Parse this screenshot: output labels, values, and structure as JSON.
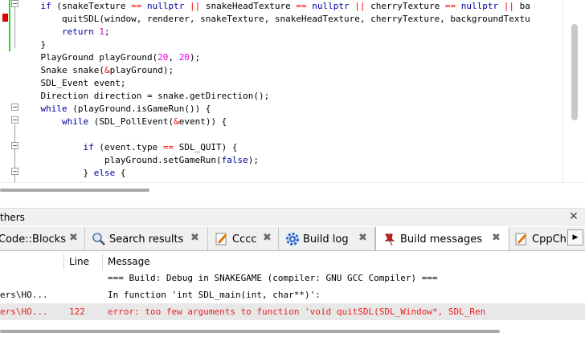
{
  "editor": {
    "lines": [
      "    if (snakeTexture == nullptr || snakeHeadTexture == nullptr || cherryTexture == nullptr || ba",
      "        quitSDL(window, renderer, snakeTexture, snakeHeadTexture, cherryTexture, backgroundTextu",
      "        return 1;",
      "    }",
      "    PlayGround playGround(20, 20);",
      "    Snake snake(&playGround);",
      "    SDL_Event event;",
      "    Direction direction = snake.getDirection();",
      "    while (playGround.isGameRun()) {",
      "        while (SDL_PollEvent(&event)) {",
      "",
      "            if (event.type == SDL_QUIT) {",
      "                playGround.setGameRun(false);",
      "            } else {"
    ]
  },
  "panel": {
    "title": "thers",
    "close_glyph": "✕"
  },
  "tabs": [
    {
      "label": "Code::Blocks",
      "icon": "codeblocks-icon"
    },
    {
      "label": "Search results",
      "icon": "search-icon"
    },
    {
      "label": "Cccc",
      "icon": "pencil-icon"
    },
    {
      "label": "Build log",
      "icon": "gear-icon"
    },
    {
      "label": "Build messages",
      "icon": "pin-icon"
    },
    {
      "label": "CppCh",
      "icon": "pencil-icon"
    }
  ],
  "tab_close_glyph": "✖",
  "tab_scroll_glyph": "▶",
  "table": {
    "headers": {
      "file": "",
      "line": "Line",
      "message": "Message"
    },
    "rows": [
      {
        "file": "",
        "line": "",
        "message": "=== Build: Debug in SNAKEGAME (compiler: GNU GCC Compiler) ===",
        "type": "info"
      },
      {
        "file": "ers\\HO...",
        "line": "",
        "message": "In function 'int SDL_main(int, char**)':",
        "type": "info"
      },
      {
        "file": "ers\\HO...",
        "line": "122",
        "message": "error: too few arguments to function 'void quitSDL(SDL_Window*, SDL_Ren",
        "type": "error"
      }
    ]
  }
}
